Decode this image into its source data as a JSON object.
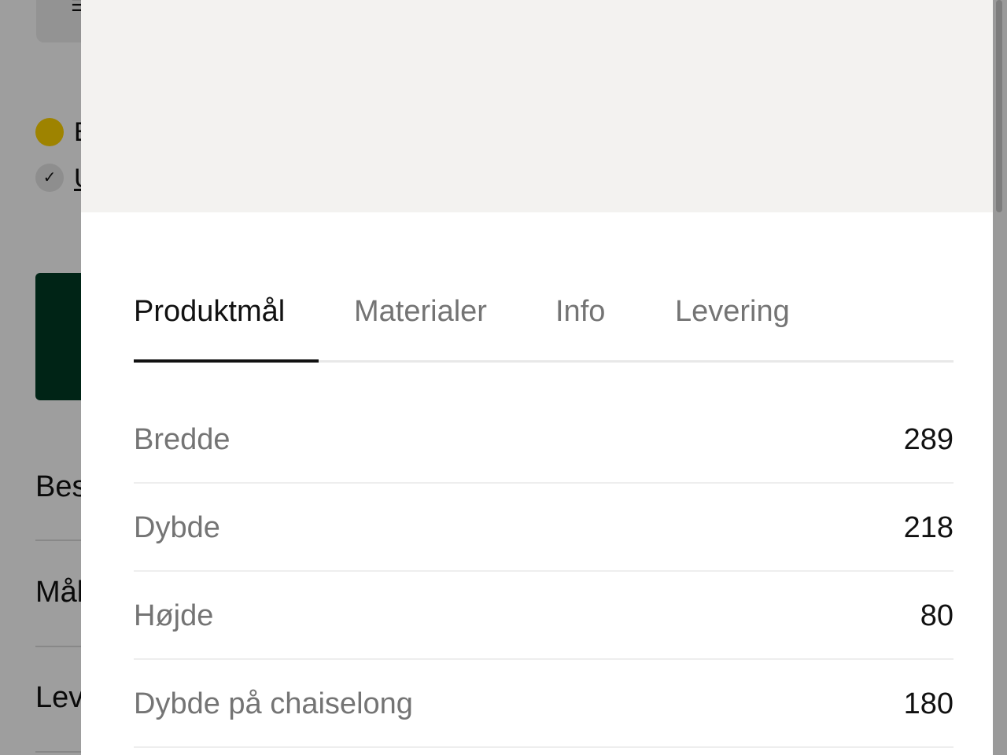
{
  "background": {
    "top_button_glyph": "☰",
    "dot_label": "E",
    "check_label": "U",
    "rows": [
      "Bes",
      "Mål",
      "Lev"
    ],
    "dot_color": "#ffd400",
    "cta_color": "#003b25"
  },
  "panel": {
    "tabs": [
      {
        "label": "Produktmål",
        "active": true
      },
      {
        "label": "Materialer",
        "active": false
      },
      {
        "label": "Info",
        "active": false
      },
      {
        "label": "Levering",
        "active": false
      }
    ],
    "specs": [
      {
        "label": "Bredde",
        "value": "289"
      },
      {
        "label": "Dybde",
        "value": "218"
      },
      {
        "label": "Højde",
        "value": "80"
      },
      {
        "label": "Dybde på chaiselong",
        "value": "180"
      }
    ]
  }
}
